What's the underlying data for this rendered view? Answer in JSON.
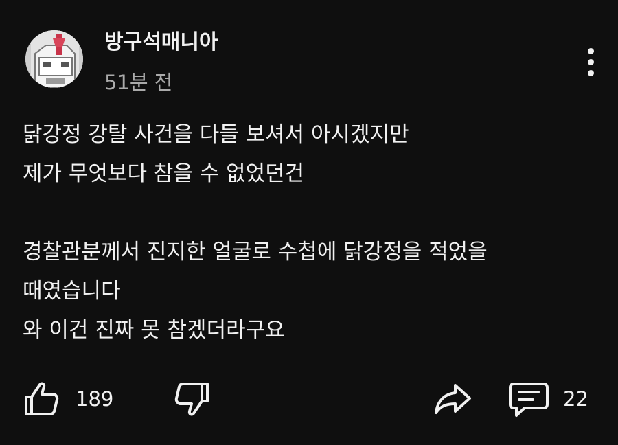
{
  "comment": {
    "author": "방구석매니아",
    "time": "51분 전",
    "body_lines": [
      "닭강정 강탈 사건을 다들 보셔서 아시겠지만",
      "제가 무엇보다 참을 수 없었던건",
      "",
      "경찰관분께서 진지한 얼굴로 수첩에 닭강정을 적었을",
      "때였습니다",
      "와 이건 진짜 못 참겠더라구요"
    ]
  },
  "actions": {
    "like_count": "189",
    "reply_count": "22"
  },
  "icons": {
    "avatar": "robot-avatar-icon",
    "more": "more-vertical-icon",
    "like": "thumbs-up-icon",
    "dislike": "thumbs-down-icon",
    "share": "share-icon",
    "reply": "comment-icon"
  },
  "colors": {
    "background": "#0f0f0f",
    "text": "#f1f1f1",
    "secondary_text": "#aaaaaa"
  }
}
